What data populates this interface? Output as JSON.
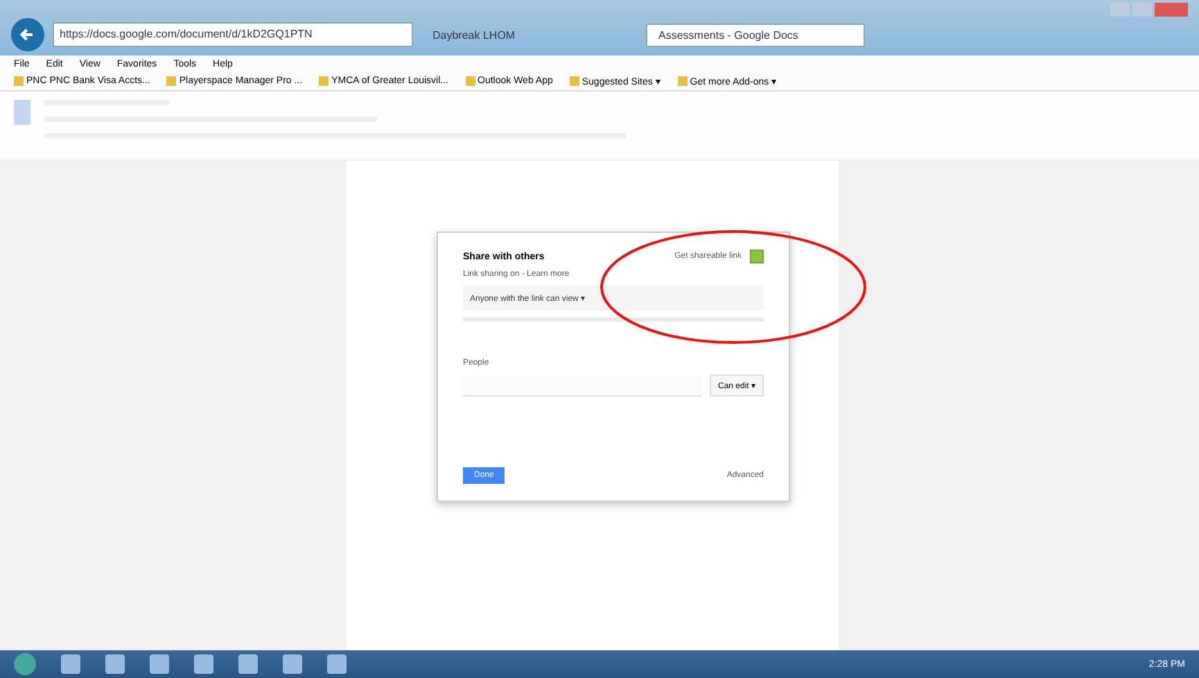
{
  "browser": {
    "address": "https://docs.google.com/document/d/1kD2GQ1PTN",
    "tabs": [
      {
        "label": "Daybreak LHOM",
        "selected": false
      },
      {
        "label": "Assessments - Google Docs",
        "selected": true
      }
    ],
    "menu": [
      "File",
      "Edit",
      "View",
      "Favorites",
      "Tools",
      "Help"
    ],
    "favorites": [
      {
        "label": "PNC PNC Bank Visa Accts..."
      },
      {
        "label": "Playerspace Manager Pro ..."
      },
      {
        "label": "YMCA of Greater Louisvil..."
      },
      {
        "label": "Outlook Web App"
      },
      {
        "label": "Suggested Sites ▾"
      },
      {
        "label": "Get more Add-ons ▾"
      }
    ]
  },
  "dialog": {
    "title": "Share with others",
    "link_label": "Get shareable link",
    "link_on": true,
    "link_sharing": "Link sharing on - Learn more",
    "link_option": "Anyone with the link can view ▾",
    "people_label": "People",
    "permission": "Can edit ▾",
    "done": "Done",
    "advanced": "Advanced"
  },
  "taskbar": {
    "clock": "2:28 PM"
  }
}
